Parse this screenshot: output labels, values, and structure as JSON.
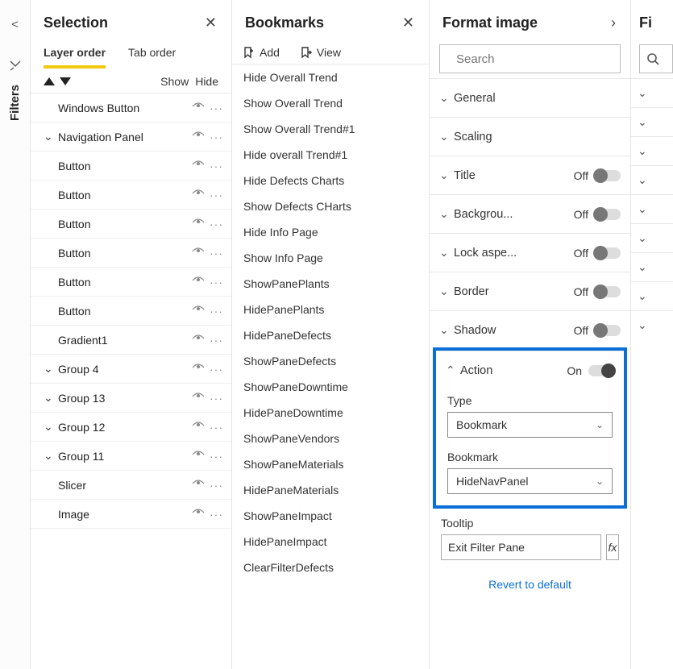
{
  "rail": {
    "collapse_glyph": "<",
    "filter_icon_glyph": "⤿",
    "filters_label": "Filters"
  },
  "selection": {
    "title": "Selection",
    "tabs": {
      "layer": "Layer order",
      "tab": "Tab order"
    },
    "show": "Show",
    "hide": "Hide",
    "items": [
      {
        "label": "Windows Button",
        "hasChevron": false
      },
      {
        "label": "Navigation Panel",
        "hasChevron": true
      },
      {
        "label": "Button",
        "hasChevron": false
      },
      {
        "label": "Button",
        "hasChevron": false
      },
      {
        "label": "Button",
        "hasChevron": false
      },
      {
        "label": "Button",
        "hasChevron": false
      },
      {
        "label": "Button",
        "hasChevron": false
      },
      {
        "label": "Button",
        "hasChevron": false
      },
      {
        "label": "Gradient1",
        "hasChevron": false
      },
      {
        "label": "Group 4",
        "hasChevron": true
      },
      {
        "label": "Group 13",
        "hasChevron": true
      },
      {
        "label": "Group 12",
        "hasChevron": true
      },
      {
        "label": "Group 11",
        "hasChevron": true
      },
      {
        "label": "Slicer",
        "hasChevron": false
      },
      {
        "label": "Image",
        "hasChevron": false
      }
    ],
    "dots": "···",
    "chevron_glyph": "⌄"
  },
  "bookmarks": {
    "title": "Bookmarks",
    "add": "Add",
    "view": "View",
    "items": [
      "Hide Overall Trend",
      "Show Overall Trend",
      "Show Overall Trend#1",
      "Hide overall Trend#1",
      "Hide Defects Charts",
      "Show Defects CHarts",
      "Hide Info Page",
      "Show Info Page",
      "ShowPanePlants",
      "HidePanePlants",
      "HidePaneDefects",
      "ShowPaneDefects",
      "ShowPaneDowntime",
      "HidePaneDowntime",
      "ShowPaneVendors",
      "ShowPaneMaterials",
      "HidePaneMaterials",
      "ShowPaneImpact",
      "HidePaneImpact",
      "ClearFilterDefects"
    ]
  },
  "format": {
    "title": "Format image",
    "search_placeholder": "Search",
    "groups": [
      {
        "label": "General",
        "expanded": false,
        "state": null
      },
      {
        "label": "Scaling",
        "expanded": false,
        "state": null
      },
      {
        "label": "Title",
        "expanded": false,
        "state": "Off"
      },
      {
        "label": "Backgrou...",
        "expanded": false,
        "state": "Off"
      },
      {
        "label": "Lock aspe...",
        "expanded": false,
        "state": "Off"
      },
      {
        "label": "Border",
        "expanded": false,
        "state": "Off"
      },
      {
        "label": "Shadow",
        "expanded": false,
        "state": "Off"
      },
      {
        "label": "Action",
        "expanded": true,
        "state": "On"
      }
    ],
    "action": {
      "type_label": "Type",
      "type_value": "Bookmark",
      "bookmark_label": "Bookmark",
      "bookmark_value": "HideNavPanel"
    },
    "tooltip_label": "Tooltip",
    "tooltip_value": "Exit Filter Pane",
    "fx": "fx",
    "revert": "Revert to default"
  },
  "fields": {
    "title": "Fi",
    "collapsed_rows": 9
  }
}
